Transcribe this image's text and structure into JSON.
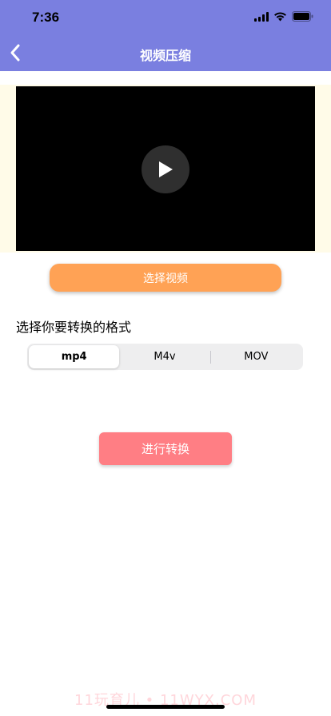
{
  "status_bar": {
    "time": "7:36"
  },
  "nav": {
    "title": "视频压缩"
  },
  "actions": {
    "select_video_label": "选择视频",
    "convert_label": "进行转换"
  },
  "format": {
    "prompt": "选择你要转换的格式",
    "options": [
      "mp4",
      "M4v",
      "MOV"
    ],
    "selected": "mp4"
  },
  "watermark": "11玩育儿 • 11WYX.COM",
  "colors": {
    "header": "#7a7fe0",
    "select_video_button": "#ffa255",
    "convert_button": "#ff7e84",
    "video_band": "#fffbe8"
  },
  "icons": {
    "back": "chevron-left-icon",
    "play": "play-icon",
    "signal": "cellular-signal-icon",
    "wifi": "wifi-icon",
    "battery": "battery-icon"
  }
}
